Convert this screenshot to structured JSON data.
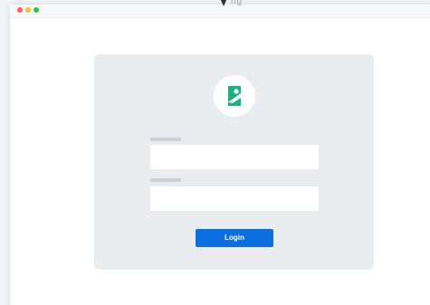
{
  "window": {
    "controls": [
      "close",
      "minimize",
      "maximize"
    ]
  },
  "cursor": {
    "icon": "arrow-cursor-icon",
    "label": "ng"
  },
  "login_form": {
    "logo_icon": "green-tag-logo-icon",
    "logo_color": "#18b37e",
    "username": {
      "label": "",
      "value": "",
      "placeholder": ""
    },
    "password": {
      "label": "",
      "value": "",
      "placeholder": ""
    },
    "login_label": "Login",
    "accent_color": "#0b6fe0"
  }
}
